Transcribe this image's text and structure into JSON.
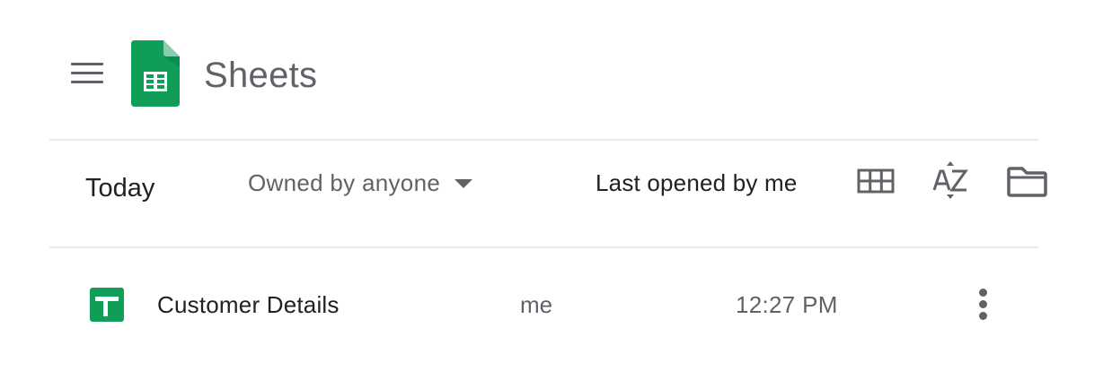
{
  "header": {
    "app_title": "Sheets",
    "menu_icon": "hamburger-menu-icon",
    "logo_icon": "google-sheets-logo-icon",
    "brand_color": "#0f9d58"
  },
  "toolbar": {
    "section_title": "Today",
    "owner_filter_label": "Owned by anyone",
    "sort_label": "Last opened by me",
    "view_icon": "grid-view-icon",
    "sort_icon": "sort-az-icon",
    "folder_icon": "folder-icon"
  },
  "files": [
    {
      "name": "Customer Details",
      "owner": "me",
      "last_opened": "12:27 PM",
      "icon": "sheets-file-icon",
      "menu_icon": "more-vert-icon"
    }
  ]
}
